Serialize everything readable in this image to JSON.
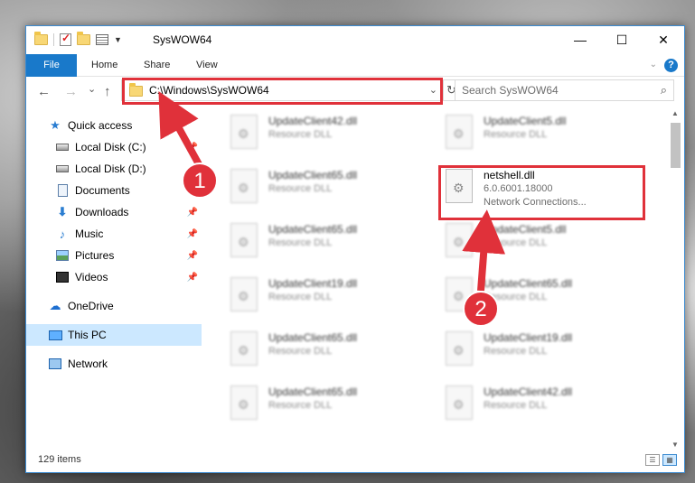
{
  "window": {
    "title": "SysWOW64",
    "controls": {
      "minimize": "—",
      "maximize": "☐",
      "close": "✕"
    }
  },
  "ribbon": {
    "tabs": [
      {
        "label": "File"
      },
      {
        "label": "Home"
      },
      {
        "label": "Share"
      },
      {
        "label": "View"
      }
    ],
    "help": "?"
  },
  "nav": {
    "address": "C:\\Windows\\SysWOW64",
    "search_placeholder": "Search SysWOW64",
    "back_icon": "←",
    "forward_icon": "→",
    "recent_icon": "⌄",
    "up_icon": "↑",
    "refresh_icon": "↻",
    "search_icon": "⌕"
  },
  "sidebar": {
    "items": [
      {
        "label": "Quick access",
        "icon": "star-icon"
      },
      {
        "label": "Local Disk (C:)",
        "icon": "disk-icon"
      },
      {
        "label": "Local Disk (D:)",
        "icon": "disk-icon"
      },
      {
        "label": "Documents",
        "icon": "documents-icon"
      },
      {
        "label": "Downloads",
        "icon": "downloads-icon"
      },
      {
        "label": "Music",
        "icon": "music-icon"
      },
      {
        "label": "Pictures",
        "icon": "pictures-icon"
      },
      {
        "label": "Videos",
        "icon": "videos-icon"
      },
      {
        "label": "OneDrive",
        "icon": "onedrive-icon"
      },
      {
        "label": "This PC",
        "icon": "pc-icon"
      },
      {
        "label": "Network",
        "icon": "network-icon"
      }
    ]
  },
  "files": [
    {
      "name": "UpdateClient42.dll",
      "meta1": "Resource DLL",
      "meta2": ""
    },
    {
      "name": "UpdateClient5.dll",
      "meta1": "Resource DLL",
      "meta2": ""
    },
    {
      "name": "UpdateClient65.dll",
      "meta1": "Resource DLL",
      "meta2": ""
    },
    {
      "name": "netshell.dll",
      "meta1": "6.0.6001.18000",
      "meta2": "Network Connections..."
    },
    {
      "name": "UpdateClient65.dll",
      "meta1": "Resource DLL",
      "meta2": ""
    },
    {
      "name": "UpdateClient5.dll",
      "meta1": "Resource DLL",
      "meta2": ""
    },
    {
      "name": "UpdateClient19.dll",
      "meta1": "Resource DLL",
      "meta2": ""
    },
    {
      "name": "UpdateClient65.dll",
      "meta1": "Resource DLL",
      "meta2": ""
    },
    {
      "name": "UpdateClient65.dll",
      "meta1": "Resource DLL",
      "meta2": ""
    },
    {
      "name": "UpdateClient19.dll",
      "meta1": "Resource DLL",
      "meta2": ""
    },
    {
      "name": "UpdateClient65.dll",
      "meta1": "Resource DLL",
      "meta2": ""
    },
    {
      "name": "UpdateClient42.dll",
      "meta1": "Resource DLL",
      "meta2": ""
    }
  ],
  "status": {
    "item_count": "129 items"
  },
  "callouts": {
    "one": "1",
    "two": "2"
  },
  "colors": {
    "accent": "#1979ca",
    "highlight": "#e0313a",
    "selected": "#cce8ff"
  }
}
